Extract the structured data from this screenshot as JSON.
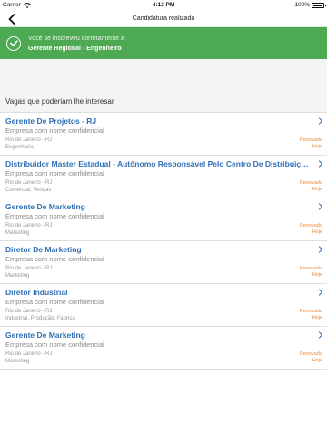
{
  "status": {
    "carrier": "Carrier",
    "time": "4:12 PM",
    "battery": "100%",
    "battery_level": 1.0
  },
  "nav": {
    "title": "Candidatura realizada"
  },
  "banner": {
    "line1": "Você se inscreveu corretamente a",
    "line2": "Gerente Regional - Engenheiro"
  },
  "section": {
    "title": "Vagas que poderiam lhe interesar"
  },
  "jobs": [
    {
      "title": "Gerente De Projetos - RJ",
      "company": "Empresa com nome confidencial",
      "location": "Rio de Janeiro - RJ",
      "category": "Engenharia",
      "renewed": "Renovada",
      "when": "Hoje"
    },
    {
      "title": "Distribuidor Master Estadual - Autônomo Responsável Pelo Centro De Distribuição Do E...",
      "company": "Empresa com nome confidencial",
      "location": "Rio de Janeiro - RJ",
      "category": "Comercial, Vendas",
      "renewed": "Renovada",
      "when": "Hoje"
    },
    {
      "title": "Gerente De Marketing",
      "company": "Empresa com nome confidencial",
      "location": "Rio de Janeiro - RJ",
      "category": "Marketing",
      "renewed": "Renovada",
      "when": "Hoje"
    },
    {
      "title": "Diretor De Marketing",
      "company": "Empresa com nome confidencial",
      "location": "Rio de Janeiro - RJ",
      "category": "Marketing",
      "renewed": "Renovada",
      "when": "Hoje"
    },
    {
      "title": "Diretor Industrial",
      "company": "Empresa com nome confidencial",
      "location": "Rio de Janeiro - RJ",
      "category": "Industrial, Produção, Fábrica",
      "renewed": "Renovada",
      "when": "Hoje"
    },
    {
      "title": "Gerente De Marketing",
      "company": "Empresa com nome confidencial",
      "location": "Rio de Janeiro - RJ",
      "category": "Marketing",
      "renewed": "Renovada",
      "when": "Hoje"
    }
  ],
  "colors": {
    "banner": "#4ea953",
    "link": "#2f6fb5",
    "renewed": "#e8893c"
  },
  "icons": {
    "back": "chevron-left-icon",
    "check": "check-circle-icon",
    "row": "chevron-right-icon",
    "wifi": "wifi-icon",
    "battery": "battery-icon"
  }
}
